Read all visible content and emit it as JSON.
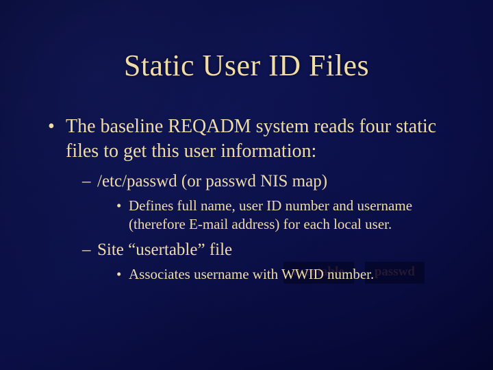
{
  "title": "Static User ID Files",
  "bullets": {
    "l1": "The baseline REQADM system reads four static files to get this user information:",
    "l2a": "/etc/passwd (or passwd NIS map)",
    "l3a": "Defines full name, user ID number and username (therefore E-mail address) for each local user.",
    "l2b": "Site “usertable” file",
    "l3b": "Associates username with WWID number."
  },
  "decor": {
    "box1": "usertable",
    "box2": "passwd"
  }
}
